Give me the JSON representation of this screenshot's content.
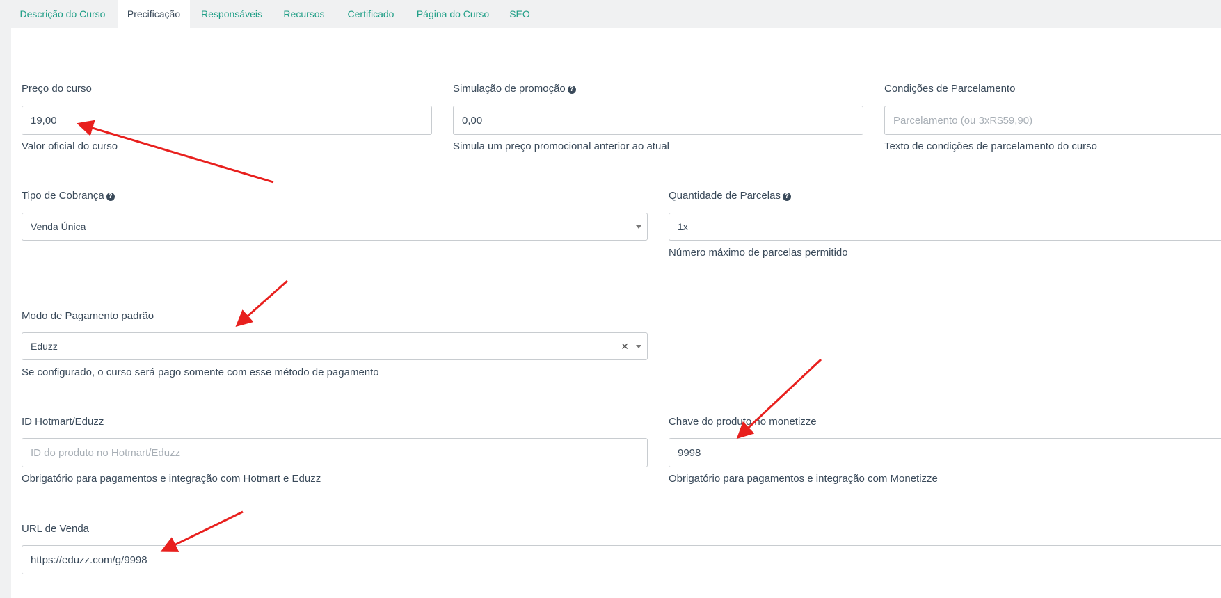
{
  "tabs": [
    {
      "label": "Descrição do Curso"
    },
    {
      "label": "Precificação",
      "active": true
    },
    {
      "label": "Responsáveis"
    },
    {
      "label": "Recursos"
    },
    {
      "label": "Certificado"
    },
    {
      "label": "Página do Curso"
    },
    {
      "label": "SEO"
    }
  ],
  "price": {
    "label": "Preço do curso",
    "value": "19,00",
    "hint": "Valor oficial do curso"
  },
  "promo": {
    "label": "Simulação de promoção",
    "value": "0,00",
    "hint": "Simula um preço promocional anterior ao atual"
  },
  "installment_terms": {
    "label": "Condições de Parcelamento",
    "placeholder": "Parcelamento (ou 3xR$59,90)",
    "hint": "Texto de condições de parcelamento do curso"
  },
  "billing_type": {
    "label": "Tipo de Cobrança",
    "value": "Venda Única"
  },
  "installments": {
    "label": "Quantidade de Parcelas",
    "value": "1x",
    "hint": "Número máximo de parcelas permitido"
  },
  "payment_mode": {
    "label": "Modo de Pagamento padrão",
    "value": "Eduzz",
    "hint": "Se configurado, o curso será pago somente com esse método de pagamento"
  },
  "hotmart_id": {
    "label": "ID Hotmart/Eduzz",
    "placeholder": "ID do produto no Hotmart/Eduzz",
    "hint": "Obrigatório para pagamentos e integração com Hotmart e Eduzz"
  },
  "monetizze_key": {
    "label": "Chave do produto no monetizze",
    "value": "9998",
    "hint": "Obrigatório para pagamentos e integração com Monetizze"
  },
  "sale_url": {
    "label": "URL de Venda",
    "value": "https://eduzz.com/g/9998"
  },
  "icons": {
    "help": "question-circle-icon",
    "clear": "times-icon",
    "caret": "caret-down-icon"
  },
  "colors": {
    "tab_link": "#1f9e86",
    "annotation_arrow": "#e8201e",
    "text": "#3a4a5a"
  }
}
